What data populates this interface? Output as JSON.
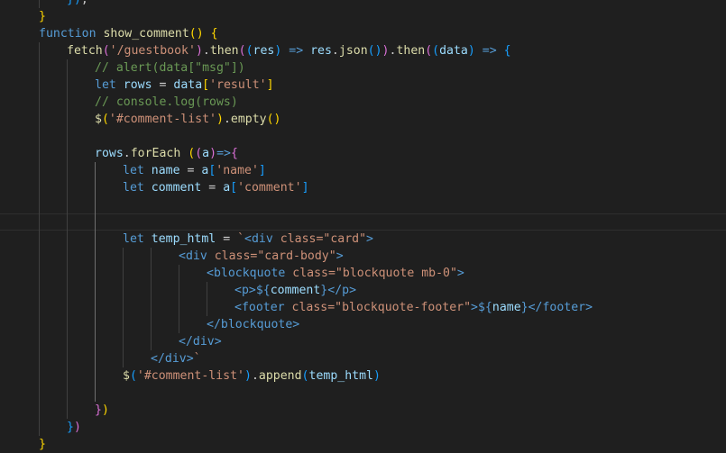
{
  "editor": {
    "language": "javascript",
    "theme_colors": {
      "background": "#1f1f1f",
      "keyword": "#569cd6",
      "function": "#dcdcaa",
      "variable": "#9cdcfe",
      "string": "#ce9178",
      "comment": "#6a9955",
      "bracket_level_1": "#ffd700",
      "bracket_level_2": "#da70d6",
      "bracket_level_3": "#179fff"
    },
    "lines": [
      {
        "indent": 1,
        "tokens": [
          [
            "b3",
            "})"
          ],
          [
            "p",
            ";"
          ]
        ]
      },
      {
        "indent": 0,
        "tokens": [
          [
            "b1",
            "}"
          ]
        ]
      },
      {
        "indent": 0,
        "tokens": [
          [
            "k",
            "function"
          ],
          [
            "p",
            " "
          ],
          [
            "f",
            "show_comment"
          ],
          [
            "b1",
            "()"
          ],
          [
            "p",
            " "
          ],
          [
            "b1",
            "{"
          ]
        ]
      },
      {
        "indent": 1,
        "tokens": [
          [
            "f",
            "fetch"
          ],
          [
            "b2",
            "("
          ],
          [
            "s",
            "'/guestbook'"
          ],
          [
            "b2",
            ")"
          ],
          [
            "p",
            "."
          ],
          [
            "f",
            "then"
          ],
          [
            "b2",
            "("
          ],
          [
            "b3",
            "("
          ],
          [
            "v",
            "res"
          ],
          [
            "b3",
            ")"
          ],
          [
            "p",
            " "
          ],
          [
            "k",
            "=>"
          ],
          [
            "p",
            " "
          ],
          [
            "v",
            "res"
          ],
          [
            "p",
            "."
          ],
          [
            "f",
            "json"
          ],
          [
            "b3",
            "()"
          ],
          [
            "b2",
            ")"
          ],
          [
            "p",
            "."
          ],
          [
            "f",
            "then"
          ],
          [
            "b2",
            "("
          ],
          [
            "b3",
            "("
          ],
          [
            "v",
            "data"
          ],
          [
            "b3",
            ")"
          ],
          [
            "p",
            " "
          ],
          [
            "k",
            "=>"
          ],
          [
            "p",
            " "
          ],
          [
            "b3",
            "{"
          ]
        ]
      },
      {
        "indent": 2,
        "tokens": [
          [
            "c",
            "// alert(data[\"msg\"])"
          ]
        ]
      },
      {
        "indent": 2,
        "tokens": [
          [
            "k",
            "let"
          ],
          [
            "p",
            " "
          ],
          [
            "v",
            "rows"
          ],
          [
            "p",
            " = "
          ],
          [
            "v",
            "data"
          ],
          [
            "b1",
            "["
          ],
          [
            "s",
            "'result'"
          ],
          [
            "b1",
            "]"
          ]
        ]
      },
      {
        "indent": 2,
        "tokens": [
          [
            "c",
            "// console.log(rows)"
          ]
        ]
      },
      {
        "indent": 2,
        "tokens": [
          [
            "f",
            "$"
          ],
          [
            "b1",
            "("
          ],
          [
            "s",
            "'#comment-list'"
          ],
          [
            "b1",
            ")"
          ],
          [
            "p",
            "."
          ],
          [
            "f",
            "empty"
          ],
          [
            "b1",
            "()"
          ]
        ]
      },
      {
        "indent": 0,
        "tokens": []
      },
      {
        "indent": 2,
        "tokens": [
          [
            "v",
            "rows"
          ],
          [
            "p",
            "."
          ],
          [
            "f",
            "forEach"
          ],
          [
            "p",
            " "
          ],
          [
            "b1",
            "("
          ],
          [
            "b2",
            "("
          ],
          [
            "v",
            "a"
          ],
          [
            "b2",
            ")"
          ],
          [
            "k",
            "=>"
          ],
          [
            "b2",
            "{"
          ]
        ]
      },
      {
        "indent": 3,
        "tokens": [
          [
            "k",
            "let"
          ],
          [
            "p",
            " "
          ],
          [
            "v",
            "name"
          ],
          [
            "p",
            " = "
          ],
          [
            "v",
            "a"
          ],
          [
            "b3",
            "["
          ],
          [
            "s",
            "'name'"
          ],
          [
            "b3",
            "]"
          ]
        ]
      },
      {
        "indent": 3,
        "tokens": [
          [
            "k",
            "let"
          ],
          [
            "p",
            " "
          ],
          [
            "v",
            "comment"
          ],
          [
            "p",
            " = "
          ],
          [
            "v",
            "a"
          ],
          [
            "b3",
            "["
          ],
          [
            "s",
            "'comment'"
          ],
          [
            "b3",
            "]"
          ]
        ]
      },
      {
        "indent": 0,
        "tokens": []
      },
      {
        "indent": 0,
        "tokens": []
      },
      {
        "indent": 3,
        "tokens": [
          [
            "k",
            "let"
          ],
          [
            "p",
            " "
          ],
          [
            "v",
            "temp_html"
          ],
          [
            "p",
            " = "
          ],
          [
            "s",
            "`"
          ],
          [
            "t",
            "<div"
          ],
          [
            "p",
            " "
          ],
          [
            "s",
            "class=\"card\""
          ],
          [
            "t",
            ">"
          ]
        ]
      },
      {
        "indent": 5,
        "tokens": [
          [
            "t",
            "<div"
          ],
          [
            "p",
            " "
          ],
          [
            "s",
            "class=\"card-body\""
          ],
          [
            "t",
            ">"
          ]
        ]
      },
      {
        "indent": 6,
        "tokens": [
          [
            "t",
            "<blockquote"
          ],
          [
            "p",
            " "
          ],
          [
            "s",
            "class=\"blockquote mb-0\""
          ],
          [
            "t",
            ">"
          ]
        ]
      },
      {
        "indent": 7,
        "tokens": [
          [
            "t",
            "<p>"
          ],
          [
            "k",
            "${"
          ],
          [
            "v",
            "comment"
          ],
          [
            "k",
            "}"
          ],
          [
            "t",
            "</p>"
          ]
        ]
      },
      {
        "indent": 7,
        "tokens": [
          [
            "t",
            "<footer"
          ],
          [
            "p",
            " "
          ],
          [
            "s",
            "class=\"blockquote-footer\""
          ],
          [
            "t",
            ">"
          ],
          [
            "k",
            "${"
          ],
          [
            "v",
            "name"
          ],
          [
            "k",
            "}"
          ],
          [
            "t",
            "</footer>"
          ]
        ]
      },
      {
        "indent": 6,
        "tokens": [
          [
            "t",
            "</blockquote>"
          ]
        ]
      },
      {
        "indent": 5,
        "tokens": [
          [
            "t",
            "</div>"
          ]
        ]
      },
      {
        "indent": 4,
        "tokens": [
          [
            "t",
            "</div>"
          ],
          [
            "s",
            "`"
          ]
        ]
      },
      {
        "indent": 3,
        "tokens": [
          [
            "f",
            "$"
          ],
          [
            "b3",
            "("
          ],
          [
            "s",
            "'#comment-list'"
          ],
          [
            "b3",
            ")"
          ],
          [
            "p",
            "."
          ],
          [
            "f",
            "append"
          ],
          [
            "b3",
            "("
          ],
          [
            "v",
            "temp_html"
          ],
          [
            "b3",
            ")"
          ]
        ]
      },
      {
        "indent": 0,
        "tokens": []
      },
      {
        "indent": 2,
        "tokens": [
          [
            "b2",
            "}"
          ],
          [
            "b1",
            ")"
          ]
        ]
      },
      {
        "indent": 1,
        "tokens": [
          [
            "b3",
            "}"
          ],
          [
            "b2",
            ")"
          ]
        ]
      },
      {
        "indent": 0,
        "tokens": [
          [
            "b1",
            "}"
          ]
        ]
      }
    ]
  }
}
